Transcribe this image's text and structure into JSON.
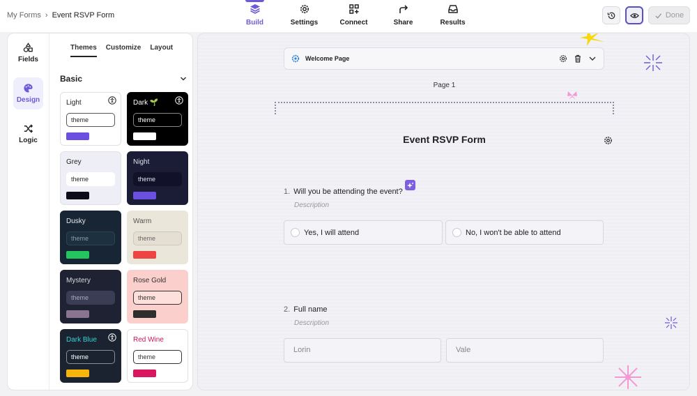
{
  "breadcrumb": {
    "parent": "My Forms",
    "separator": "›",
    "current": "Event RSVP Form"
  },
  "nav": [
    {
      "label": "Build",
      "icon": "layers-icon",
      "active": true
    },
    {
      "label": "Settings",
      "icon": "gear-icon"
    },
    {
      "label": "Connect",
      "icon": "connect-icon"
    },
    {
      "label": "Share",
      "icon": "share-icon"
    },
    {
      "label": "Results",
      "icon": "inbox-icon"
    }
  ],
  "top_actions": {
    "history_icon": "history-icon",
    "preview_icon": "eye-icon",
    "done_label": "Done"
  },
  "rail": [
    {
      "label": "Fields",
      "icon": "shapes-icon"
    },
    {
      "label": "Design",
      "icon": "palette-icon",
      "active": true
    },
    {
      "label": "Logic",
      "icon": "shuffle-icon"
    }
  ],
  "design_tabs": [
    "Themes",
    "Customize",
    "Layout"
  ],
  "section": {
    "title": "Basic"
  },
  "themes": [
    {
      "name": "Light",
      "pill": "theme",
      "accessible": true,
      "bg": "#ffffff",
      "text": "#222222",
      "pill_bg": "#ffffff",
      "pill_border": "#555555",
      "pill_text": "#222222",
      "swatch": "#6b4fe0",
      "border": "#e0e0e6"
    },
    {
      "name": "Dark 🌱",
      "pill": "theme",
      "accessible": true,
      "bg": "#000000",
      "text": "#ffffff",
      "pill_bg": "#000000",
      "pill_border": "#8a8a8a",
      "pill_text": "#ffffff",
      "swatch": "#ffffff",
      "border": "#000000"
    },
    {
      "name": "Grey",
      "pill": "theme",
      "bg": "#eeeff6",
      "text": "#222222",
      "pill_bg": "#ffffff",
      "pill_border": "#ffffff",
      "pill_text": "#222222",
      "swatch": "#0d0d1a",
      "border": "#e0e0e6"
    },
    {
      "name": "Night",
      "pill": "theme",
      "bg": "#1b1c36",
      "text": "#e0e0ea",
      "pill_bg": "#11122a",
      "pill_border": "#11122a",
      "pill_text": "#e0e0ea",
      "swatch": "#6b4fe0",
      "border": "#1b1c36"
    },
    {
      "name": "Dusky",
      "pill": "theme",
      "bg": "#172534",
      "text": "#e8e8ee",
      "pill_bg": "#1d3040",
      "pill_border": "#2d4456",
      "pill_text": "#8a9aa8",
      "swatch": "#22c55e",
      "border": "#172534"
    },
    {
      "name": "Warm",
      "pill": "theme",
      "bg": "#ebe6da",
      "text": "#555555",
      "pill_bg": "#e4dfd2",
      "pill_border": "#cfc8b8",
      "pill_text": "#666666",
      "swatch": "#ef4444",
      "border": "#ebe6da"
    },
    {
      "name": "Mystery",
      "pill": "theme",
      "bg": "#1f2232",
      "text": "#d8d8e2",
      "pill_bg": "#3a3d54",
      "pill_border": "#3a3d54",
      "pill_text": "#a8a8c0",
      "swatch": "#8a7590",
      "border": "#1f2232"
    },
    {
      "name": "Rose Gold",
      "pill": "theme",
      "bg": "#fbd0cc",
      "text": "#333333",
      "pill_bg": "#fde0dc",
      "pill_border": "#333333",
      "pill_text": "#333333",
      "swatch": "#2e2e2e",
      "border": "#fbd0cc"
    },
    {
      "name": "Dark Blue",
      "pill": "theme",
      "accessible": true,
      "bg": "#1c2330",
      "text": "#2fd3d3",
      "pill_bg": "#1c2330",
      "pill_border": "#8a8f99",
      "pill_text": "#ffffff",
      "swatch": "#f5b50a",
      "border": "#1c2330"
    },
    {
      "name": "Red Wine",
      "pill": "theme",
      "bg": "#ffffff",
      "text": "#c9145a",
      "pill_bg": "#ffffff",
      "pill_border": "#333333",
      "pill_text": "#333333",
      "swatch": "#d9175e",
      "border": "#e0e0e6"
    }
  ],
  "canvas": {
    "welcome_label": "Welcome Page",
    "page_label": "Page 1",
    "form_title": "Event RSVP Form",
    "q1": {
      "number": "1.",
      "label": "Will you be attending the event?",
      "description": "Description",
      "options": [
        "Yes, I will attend",
        "No, I won't be able to attend"
      ]
    },
    "q2": {
      "number": "2.",
      "label": "Full name",
      "description": "Description",
      "first_placeholder": "Lorin",
      "last_placeholder": "Vale"
    }
  },
  "colors": {
    "accent": "#6b5bd6"
  }
}
